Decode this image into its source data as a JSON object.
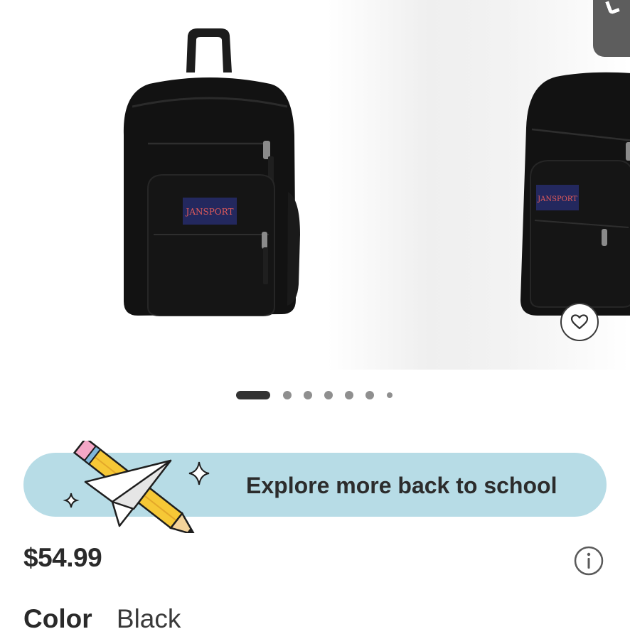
{
  "gallery": {
    "slides": [
      {
        "alt": "Black JanSport backpack front view",
        "logo_text": "JANSPORT"
      },
      {
        "alt": "Black JanSport backpack angled view",
        "logo_text": "JANSPORT"
      }
    ],
    "dots_total": 7,
    "active_index": 0
  },
  "icons": {
    "favorite": "heart-icon",
    "media": "media-icon",
    "info": "info-icon"
  },
  "promo": {
    "label": "Explore more back to school",
    "background": "#b7dce6",
    "art": "pencil-and-paper-plane"
  },
  "product": {
    "price": "$54.99",
    "color_label": "Color",
    "color_value": "Black"
  }
}
